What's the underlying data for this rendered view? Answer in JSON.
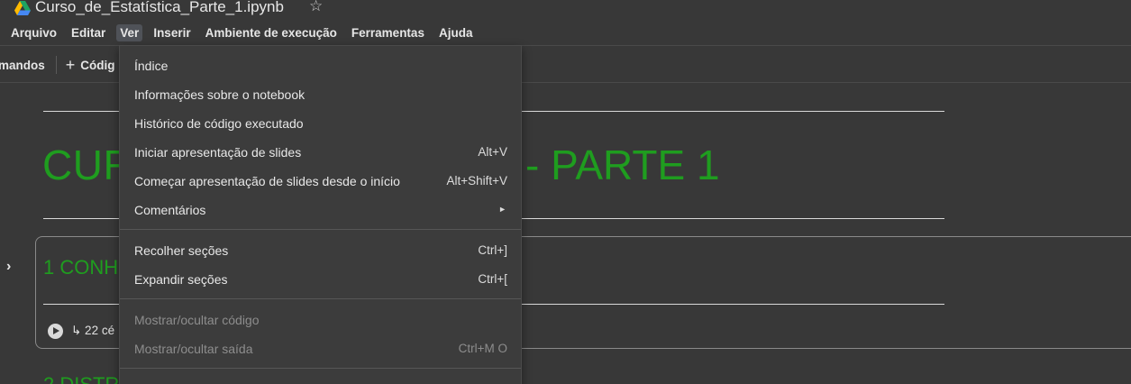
{
  "file": {
    "title": "Curso_de_Estatística_Parte_1.ipynb"
  },
  "menubar": {
    "items": [
      {
        "label": "Arquivo"
      },
      {
        "label": "Editar"
      },
      {
        "label": "Ver",
        "active": true
      },
      {
        "label": "Inserir"
      },
      {
        "label": "Ambiente de execução"
      },
      {
        "label": "Ferramentas"
      },
      {
        "label": "Ajuda"
      }
    ]
  },
  "toolbar": {
    "commands_label": "mandos",
    "code_label": "Códig"
  },
  "notebook": {
    "title_left": "CUR",
    "title_right": "- PARTE 1",
    "section1_title": "1 CONH",
    "cells_hidden": "↳ 22 cé",
    "section2_title": "2 DISTR"
  },
  "dropdown": {
    "items": [
      {
        "label": "Índice",
        "shortcut": ""
      },
      {
        "label": "Informações sobre o notebook",
        "shortcut": ""
      },
      {
        "label": "Histórico de código executado",
        "shortcut": ""
      },
      {
        "label": "Iniciar apresentação de slides",
        "shortcut": "Alt+V"
      },
      {
        "label": "Começar apresentação de slides desde o início",
        "shortcut": "Alt+Shift+V"
      },
      {
        "label": "Comentários",
        "shortcut": ""
      },
      {
        "label": "Recolher seções",
        "shortcut": "Ctrl+]"
      },
      {
        "label": "Expandir seções",
        "shortcut": "Ctrl+["
      },
      {
        "label": "Mostrar/ocultar código",
        "shortcut": ""
      },
      {
        "label": "Mostrar/ocultar saída",
        "shortcut": "Ctrl+M O"
      },
      {
        "label": "",
        "shortcut": ""
      }
    ]
  },
  "colors": {
    "background": "#383838",
    "menu_bg": "#3c3c3c",
    "heading_green": "#1f9d1f",
    "disabled_text": "#8d8d8d"
  }
}
